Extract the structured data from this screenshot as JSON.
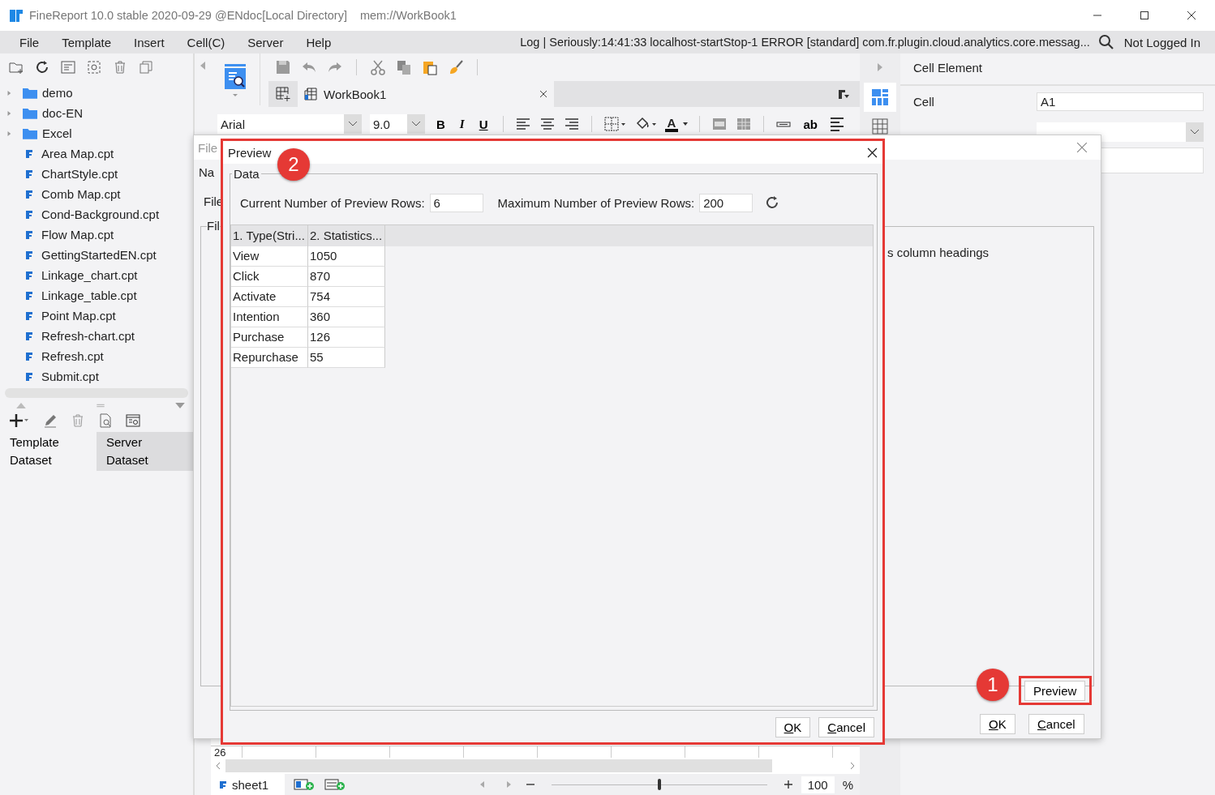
{
  "window": {
    "title": "FineReport 10.0 stable 2020-09-29 @ENdoc[Local Directory]",
    "path": "mem://WorkBook1"
  },
  "menu": [
    "File",
    "Template",
    "Insert",
    "Cell(C)",
    "Server",
    "Help"
  ],
  "log": "Log | Seriously:14:41:33 localhost-startStop-1 ERROR [standard] com.fr.plugin.cloud.analytics.core.messag...",
  "login": "Not Logged In",
  "tree": [
    {
      "label": "demo",
      "kind": "folder",
      "expanded": false
    },
    {
      "label": "doc-EN",
      "kind": "folder",
      "expanded": false
    },
    {
      "label": "Excel",
      "kind": "folder",
      "expanded": false
    },
    {
      "label": "Area Map.cpt",
      "kind": "file"
    },
    {
      "label": "ChartStyle.cpt",
      "kind": "file"
    },
    {
      "label": "Comb Map.cpt",
      "kind": "file"
    },
    {
      "label": "Cond-Background.cpt",
      "kind": "file"
    },
    {
      "label": "Flow Map.cpt",
      "kind": "file"
    },
    {
      "label": "GettingStartedEN.cpt",
      "kind": "file"
    },
    {
      "label": "Linkage_chart.cpt",
      "kind": "file"
    },
    {
      "label": "Linkage_table.cpt",
      "kind": "file"
    },
    {
      "label": "Point Map.cpt",
      "kind": "file"
    },
    {
      "label": "Refresh-chart.cpt",
      "kind": "file"
    },
    {
      "label": "Refresh.cpt",
      "kind": "file"
    },
    {
      "label": "Submit.cpt",
      "kind": "file"
    }
  ],
  "dataset_tabs": [
    {
      "label": "Template Dataset",
      "selected": true
    },
    {
      "label": "Server Dataset",
      "selected": false
    }
  ],
  "editor": {
    "tab": "WorkBook1",
    "font": "Arial",
    "size": "9.0",
    "bold": "B",
    "italic": "I",
    "underline": "U",
    "font_color": "A",
    "wrap": "ab",
    "row_number": "26",
    "sheet": "sheet1",
    "zoom": "100",
    "zoom_unit": "%",
    "zoom_slider": {
      "level": 0.5
    }
  },
  "cell_panel": {
    "title": "Cell Element",
    "cell_label": "Cell",
    "cell_value": "A1"
  },
  "back_dialog": {
    "title": "File",
    "labels": [
      "Na",
      "File",
      "Fil"
    ],
    "fragment": "s column headings",
    "preview_button": "Preview",
    "ok": "OK",
    "cancel": "Cancel"
  },
  "preview": {
    "title": "Preview",
    "group": "Data",
    "current_label": "Current Number of Preview Rows:",
    "current_value": "6",
    "max_label": "Maximum Number of Preview Rows:",
    "max_value": "200",
    "columns": [
      "1. Type(Stri...",
      "2. Statistics..."
    ],
    "rows": [
      [
        "View",
        "1050"
      ],
      [
        "Click",
        "870"
      ],
      [
        "Activate",
        "754"
      ],
      [
        "Intention",
        "360"
      ],
      [
        "Purchase",
        "126"
      ],
      [
        "Repurchase",
        "55"
      ]
    ],
    "ok": "OK",
    "cancel": "Cancel"
  },
  "callouts": [
    "1",
    "2"
  ]
}
